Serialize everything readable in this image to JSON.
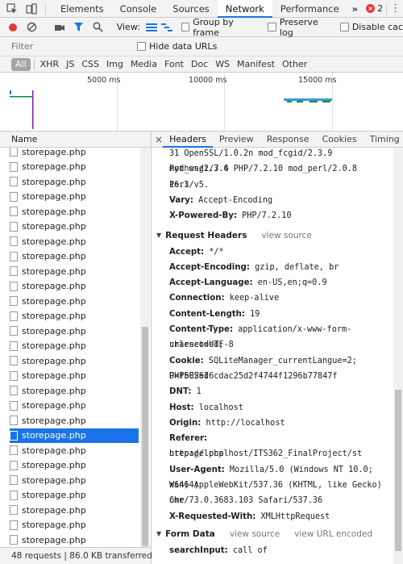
{
  "devtools": {
    "tabs": [
      "Elements",
      "Console",
      "Sources",
      "Network",
      "Performance"
    ],
    "more_glyph": "»",
    "error_count": "2"
  },
  "toolbar": {
    "view_label": "View:",
    "group_by_frame": "Group by frame",
    "preserve_log": "Preserve log",
    "disable_cache": "Disable cac"
  },
  "filter": {
    "placeholder": "Filter",
    "hide_data_urls": "Hide data URLs",
    "types": [
      "All",
      "XHR",
      "JS",
      "CSS",
      "Img",
      "Media",
      "Font",
      "Doc",
      "WS",
      "Manifest",
      "Other"
    ]
  },
  "overview": {
    "ticks": [
      "5000 ms",
      "10000 ms",
      "15000 ms"
    ]
  },
  "requests": {
    "header": "Name",
    "items": [
      "storepage.php",
      "storepage.php",
      "storepage.php",
      "storepage.php",
      "storepage.php",
      "storepage.php",
      "storepage.php",
      "storepage.php",
      "storepage.php",
      "storepage.php",
      "storepage.php",
      "storepage.php",
      "storepage.php",
      "storepage.php",
      "storepage.php",
      "storepage.php",
      "storepage.php",
      "storepage.php",
      "storepage.php",
      "storepage.php",
      "storepage.php",
      "storepage.php",
      "storepage.php",
      "storepage.php",
      "storepage.php",
      "storepage.php",
      "storepage.php"
    ],
    "selected_index": 19,
    "status": "48 requests | 86.0 KB transferred"
  },
  "details": {
    "tabs": [
      "Headers",
      "Preview",
      "Response",
      "Cookies",
      "Timing"
    ],
    "close_glyph": "×",
    "response_tail": [
      {
        "key": "",
        "value": "31 OpenSSL/1.0.2n mod_fcgid/2.3.9 mod_wsgi/3.4"
      },
      {
        "key": "",
        "value": "Python/2.7.6 PHP/7.2.10 mod_perl/2.0.8 Perl/v5."
      },
      {
        "key": "",
        "value": "16.3"
      },
      {
        "key": "Vary:",
        "value": "Accept-Encoding"
      },
      {
        "key": "X-Powered-By:",
        "value": "PHP/7.2.10"
      }
    ],
    "request_section": {
      "title": "Request Headers",
      "view_source": "view source"
    },
    "request_headers": [
      {
        "key": "Accept:",
        "value": "*/*"
      },
      {
        "key": "Accept-Encoding:",
        "value": "gzip, deflate, br"
      },
      {
        "key": "Accept-Language:",
        "value": "en-US,en;q=0.9"
      },
      {
        "key": "Connection:",
        "value": "keep-alive"
      },
      {
        "key": "Content-Length:",
        "value": "19"
      },
      {
        "key": "Content-Type:",
        "value": "application/x-www-form-urlencoded;"
      },
      {
        "key": "",
        "value": "charset=UTF-8"
      },
      {
        "key": "Cookie:",
        "value": "SQLiteManager_currentLangue=2; PHPSESSI"
      },
      {
        "key": "",
        "value": "D=fb02ed6cdac25d2f4744f1296b77847f"
      },
      {
        "key": "DNT:",
        "value": "1"
      },
      {
        "key": "Host:",
        "value": "localhost"
      },
      {
        "key": "Origin:",
        "value": "http://localhost"
      },
      {
        "key": "Referer:",
        "value": "http://localhost/ITS362_FinalProject/st"
      },
      {
        "key": "",
        "value": "orepage.php"
      },
      {
        "key": "User-Agent:",
        "value": "Mozilla/5.0 (Windows NT 10.0; Win64;"
      },
      {
        "key": "",
        "value": "x64) AppleWebKit/537.36 (KHTML, like Gecko) Chr"
      },
      {
        "key": "",
        "value": "ome/73.0.3683.103 Safari/537.36"
      },
      {
        "key": "X-Requested-With:",
        "value": "XMLHttpRequest"
      }
    ],
    "form_section": {
      "title": "Form Data",
      "view_source": "view source",
      "view_url_encoded": "view URL encoded"
    },
    "form_data": [
      {
        "key": "searchInput:",
        "value": "call of"
      }
    ]
  }
}
